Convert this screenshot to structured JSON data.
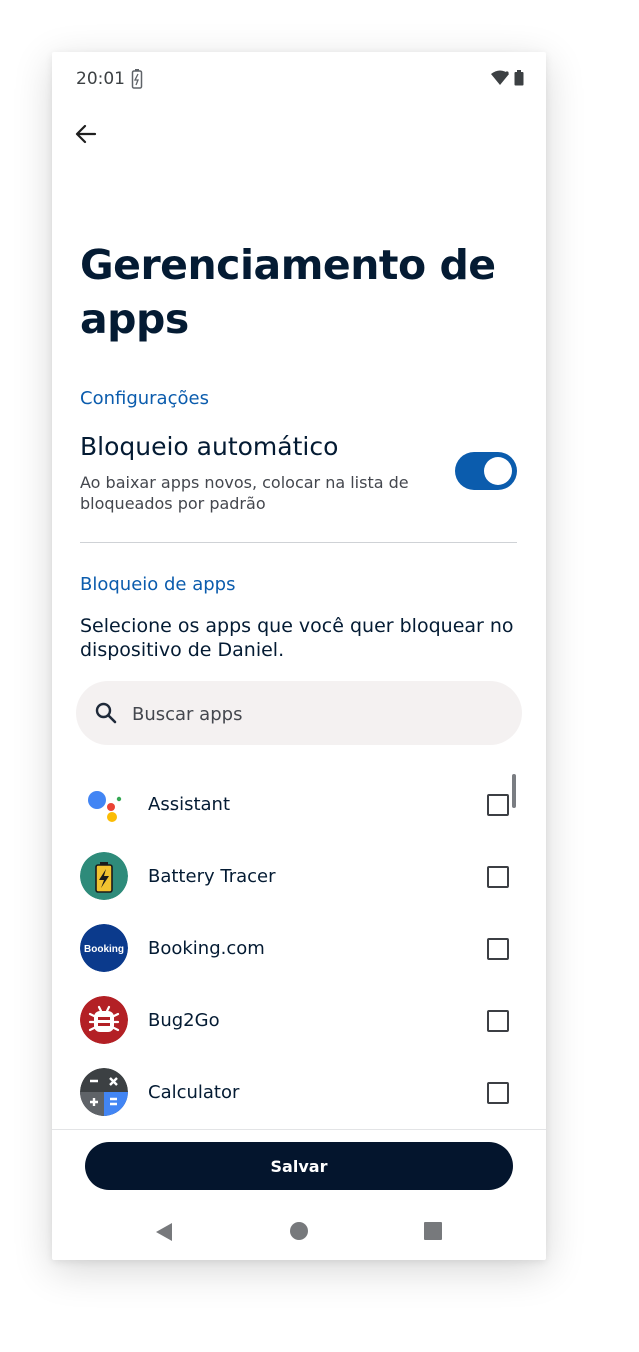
{
  "status_bar": {
    "time": "20:01"
  },
  "page": {
    "title": "Gerenciamento de apps"
  },
  "settings": {
    "header": "Configurações",
    "auto_block": {
      "title": "Bloqueio automático",
      "description": "Ao baixar apps novos, colocar na lista de bloqueados por padrão",
      "enabled": true
    }
  },
  "app_blocking": {
    "header": "Bloqueio de apps",
    "instructions": "Selecione os apps que você quer bloquear no dispositivo de Daniel.",
    "search": {
      "placeholder": "Buscar apps"
    },
    "apps": [
      {
        "name": "Assistant",
        "icon": "assistant-icon",
        "checked": false
      },
      {
        "name": "Battery Tracer",
        "icon": "battery-tracer-icon",
        "checked": false
      },
      {
        "name": "Booking.com",
        "icon": "booking-icon",
        "icon_text": "Booking",
        "checked": false
      },
      {
        "name": "Bug2Go",
        "icon": "bug2go-icon",
        "checked": false
      },
      {
        "name": "Calculator",
        "icon": "calculator-icon",
        "checked": false
      }
    ]
  },
  "footer": {
    "save_label": "Salvar"
  },
  "colors": {
    "accent": "#0b5cad",
    "title": "#041b33",
    "button": "#04152d",
    "search_bg": "#f4f1f1"
  }
}
